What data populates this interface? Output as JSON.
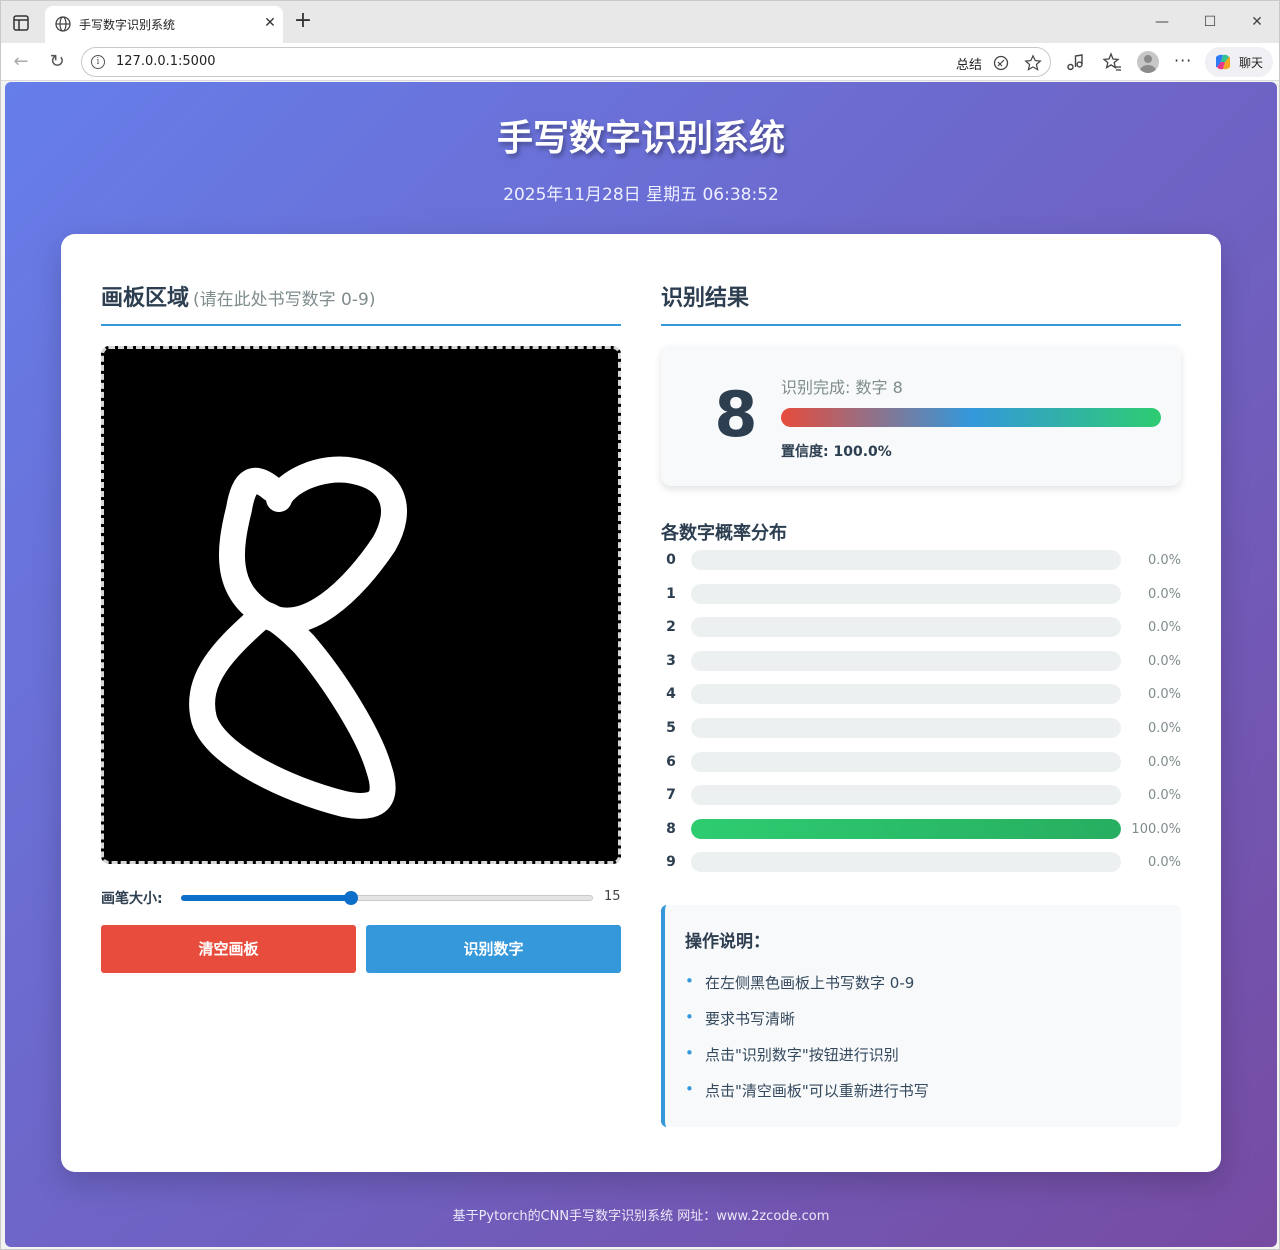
{
  "browser": {
    "tab_title": "手写数字识别系统",
    "url": "127.0.0.1:5000",
    "summary_label": "总结",
    "chat_label": "聊天",
    "tab_close": "✕",
    "new_tab": "+",
    "more": "···"
  },
  "page": {
    "title": "手写数字识别系统",
    "datetime": "2025年11月28日 星期五 06:38:52",
    "footer": "基于Pytorch的CNN手写数字识别系统 网址：www.2zcode.com"
  },
  "canvas_section": {
    "title": "画板区域",
    "subtitle": "(请在此处书写数字 0-9)",
    "pen_label": "画笔大小:",
    "pen_size": 15,
    "pen_min": 1,
    "pen_max": 35,
    "clear_button": "清空画板",
    "recognize_button": "识别数字"
  },
  "result_section": {
    "title": "识别结果",
    "digit": "8",
    "status": "识别完成: 数字 8",
    "confidence": "置信度: 100.0%",
    "distribution_title": "各数字概率分布",
    "probabilities": [
      {
        "digit": "0",
        "value": 0.0,
        "label": "0.0%"
      },
      {
        "digit": "1",
        "value": 0.0,
        "label": "0.0%"
      },
      {
        "digit": "2",
        "value": 0.0,
        "label": "0.0%"
      },
      {
        "digit": "3",
        "value": 0.0,
        "label": "0.0%"
      },
      {
        "digit": "4",
        "value": 0.0,
        "label": "0.0%"
      },
      {
        "digit": "5",
        "value": 0.0,
        "label": "0.0%"
      },
      {
        "digit": "6",
        "value": 0.0,
        "label": "0.0%"
      },
      {
        "digit": "7",
        "value": 0.0,
        "label": "0.0%"
      },
      {
        "digit": "8",
        "value": 100.0,
        "label": "100.0%"
      },
      {
        "digit": "9",
        "value": 0.0,
        "label": "0.0%"
      }
    ]
  },
  "help": {
    "title": "操作说明：",
    "items": [
      "在左侧黑色画板上书写数字 0-9",
      "要求书写清晰",
      "点击\"识别数字\"按钮进行识别",
      "点击\"清空画板\"可以重新进行书写"
    ]
  },
  "colors": {
    "gradient_start": "#667eea",
    "gradient_end": "#764ba2",
    "accent": "#3498db",
    "clear_button": "#e74c3c",
    "success": "#2ecc71"
  }
}
